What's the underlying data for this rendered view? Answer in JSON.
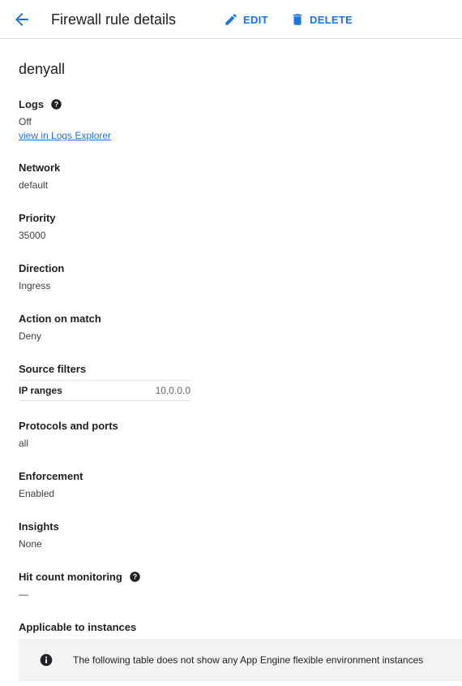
{
  "header": {
    "title": "Firewall rule details",
    "edit_label": "EDIT",
    "delete_label": "DELETE",
    "accent_color": "#1a73e8"
  },
  "rule": {
    "name": "denyall"
  },
  "logs": {
    "label": "Logs",
    "value": "Off",
    "link_text": "view in Logs Explorer"
  },
  "network": {
    "label": "Network",
    "value": "default"
  },
  "priority": {
    "label": "Priority",
    "value": "35000"
  },
  "direction": {
    "label": "Direction",
    "value": "Ingress"
  },
  "action": {
    "label": "Action on match",
    "value": "Deny"
  },
  "source_filters": {
    "label": "Source filters",
    "rows": [
      {
        "key": "IP ranges",
        "value": "10.0.0.0"
      }
    ]
  },
  "protocols": {
    "label": "Protocols and ports",
    "value": "all"
  },
  "enforcement": {
    "label": "Enforcement",
    "value": "Enabled"
  },
  "insights": {
    "label": "Insights",
    "value": "None"
  },
  "hit_count": {
    "label": "Hit count monitoring",
    "value": "—"
  },
  "instances": {
    "label": "Applicable to instances",
    "banner_text": "The following table does not show any App Engine flexible environment instances"
  }
}
